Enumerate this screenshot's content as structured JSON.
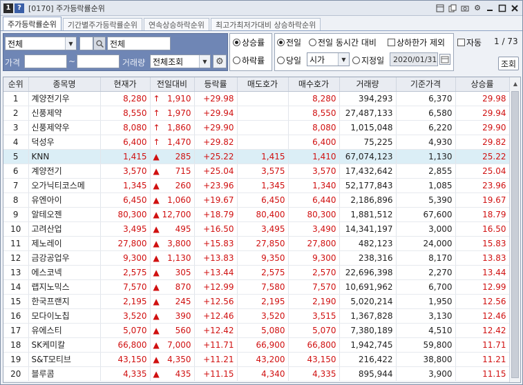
{
  "window": {
    "badge1": "1",
    "badge2": "?",
    "title": "[0170] 주가등락률순위",
    "icons": [
      "layout-icon",
      "copy-icon",
      "camera-icon",
      "gear-icon",
      "minimize-icon",
      "maximize-icon",
      "close-icon"
    ]
  },
  "tabs": [
    {
      "label": "주가등락률순위",
      "active": true
    },
    {
      "label": "기간별주가등락률순위",
      "active": false
    },
    {
      "label": "연속상승하락순위",
      "active": false
    },
    {
      "label": "최고가최저가대비 상승하락순위",
      "active": false
    }
  ],
  "filters": {
    "market_select": "전체",
    "code_input": "",
    "search_text": "전체",
    "price_label": "가격",
    "price_from": "",
    "tilde": "~",
    "price_to": "",
    "volume_label": "거래량",
    "volume_select": "전체조회"
  },
  "direction": {
    "rise": "상승률",
    "fall": "하락률",
    "selected": "rise"
  },
  "basis": {
    "prev_day": "전일",
    "prev_same_time": "전일 동시간 대비",
    "limit_exclude": "상하한가 제외",
    "today": "당일",
    "today_select": "시가",
    "set_day": "지정일",
    "date": "2020/01/31"
  },
  "auto_label": "자동",
  "pager": "1 / 73",
  "query_button": "조회",
  "columns": [
    "순위",
    "종목명",
    "현재가",
    "전일대비",
    "등락률",
    "매도호가",
    "매수호가",
    "거래량",
    "기준가격",
    "상승률"
  ],
  "rows": [
    {
      "rank": "1",
      "name": "계양전기우",
      "price": "8,280",
      "arrow": "↑",
      "chg": "1,910",
      "rate": "+29.98",
      "ask": "",
      "bid": "8,280",
      "volume": "394,293",
      "base": "6,370",
      "rise": "29.98"
    },
    {
      "rank": "2",
      "name": "신풍제약",
      "price": "8,550",
      "arrow": "↑",
      "chg": "1,970",
      "rate": "+29.94",
      "ask": "",
      "bid": "8,550",
      "volume": "27,487,133",
      "base": "6,580",
      "rise": "29.94"
    },
    {
      "rank": "3",
      "name": "신풍제약우",
      "price": "8,080",
      "arrow": "↑",
      "chg": "1,860",
      "rate": "+29.90",
      "ask": "",
      "bid": "8,080",
      "volume": "1,015,048",
      "base": "6,220",
      "rise": "29.90"
    },
    {
      "rank": "4",
      "name": "덕성우",
      "price": "6,400",
      "arrow": "↑",
      "chg": "1,470",
      "rate": "+29.82",
      "ask": "",
      "bid": "6,400",
      "volume": "75,225",
      "base": "4,930",
      "rise": "29.82"
    },
    {
      "rank": "5",
      "name": "KNN",
      "price": "1,415",
      "arrow": "▲",
      "chg": "285",
      "rate": "+25.22",
      "ask": "1,415",
      "bid": "1,410",
      "volume": "67,074,123",
      "base": "1,130",
      "rise": "25.22"
    },
    {
      "rank": "6",
      "name": "계양전기",
      "price": "3,570",
      "arrow": "▲",
      "chg": "715",
      "rate": "+25.04",
      "ask": "3,575",
      "bid": "3,570",
      "volume": "17,432,642",
      "base": "2,855",
      "rise": "25.04"
    },
    {
      "rank": "7",
      "name": "오가닉티코스메",
      "price": "1,345",
      "arrow": "▲",
      "chg": "260",
      "rate": "+23.96",
      "ask": "1,345",
      "bid": "1,340",
      "volume": "52,177,843",
      "base": "1,085",
      "rise": "23.96"
    },
    {
      "rank": "8",
      "name": "유엔아이",
      "price": "6,450",
      "arrow": "▲",
      "chg": "1,060",
      "rate": "+19.67",
      "ask": "6,450",
      "bid": "6,440",
      "volume": "2,186,896",
      "base": "5,390",
      "rise": "19.67"
    },
    {
      "rank": "9",
      "name": "알테오젠",
      "price": "80,300",
      "arrow": "▲",
      "chg": "12,700",
      "rate": "+18.79",
      "ask": "80,400",
      "bid": "80,300",
      "volume": "1,881,512",
      "base": "67,600",
      "rise": "18.79"
    },
    {
      "rank": "10",
      "name": "고려산업",
      "price": "3,495",
      "arrow": "▲",
      "chg": "495",
      "rate": "+16.50",
      "ask": "3,495",
      "bid": "3,490",
      "volume": "14,341,197",
      "base": "3,000",
      "rise": "16.50"
    },
    {
      "rank": "11",
      "name": "제노레이",
      "price": "27,800",
      "arrow": "▲",
      "chg": "3,800",
      "rate": "+15.83",
      "ask": "27,850",
      "bid": "27,800",
      "volume": "482,123",
      "base": "24,000",
      "rise": "15.83"
    },
    {
      "rank": "12",
      "name": "금강공업우",
      "price": "9,300",
      "arrow": "▲",
      "chg": "1,130",
      "rate": "+13.83",
      "ask": "9,350",
      "bid": "9,300",
      "volume": "238,316",
      "base": "8,170",
      "rise": "13.83"
    },
    {
      "rank": "13",
      "name": "에스코넥",
      "price": "2,575",
      "arrow": "▲",
      "chg": "305",
      "rate": "+13.44",
      "ask": "2,575",
      "bid": "2,570",
      "volume": "22,696,398",
      "base": "2,270",
      "rise": "13.44"
    },
    {
      "rank": "14",
      "name": "랩지노믹스",
      "price": "7,570",
      "arrow": "▲",
      "chg": "870",
      "rate": "+12.99",
      "ask": "7,580",
      "bid": "7,570",
      "volume": "10,691,962",
      "base": "6,700",
      "rise": "12.99"
    },
    {
      "rank": "15",
      "name": "한국프랜지",
      "price": "2,195",
      "arrow": "▲",
      "chg": "245",
      "rate": "+12.56",
      "ask": "2,195",
      "bid": "2,190",
      "volume": "5,020,214",
      "base": "1,950",
      "rise": "12.56"
    },
    {
      "rank": "16",
      "name": "모다이노칩",
      "price": "3,520",
      "arrow": "▲",
      "chg": "390",
      "rate": "+12.46",
      "ask": "3,520",
      "bid": "3,515",
      "volume": "1,367,828",
      "base": "3,130",
      "rise": "12.46"
    },
    {
      "rank": "17",
      "name": "유에스티",
      "price": "5,070",
      "arrow": "▲",
      "chg": "560",
      "rate": "+12.42",
      "ask": "5,080",
      "bid": "5,070",
      "volume": "7,380,189",
      "base": "4,510",
      "rise": "12.42"
    },
    {
      "rank": "18",
      "name": "SK케미칼",
      "price": "66,800",
      "arrow": "▲",
      "chg": "7,000",
      "rate": "+11.71",
      "ask": "66,900",
      "bid": "66,800",
      "volume": "1,942,745",
      "base": "59,800",
      "rise": "11.71"
    },
    {
      "rank": "19",
      "name": "S&T모티브",
      "price": "43,150",
      "arrow": "▲",
      "chg": "4,350",
      "rate": "+11.21",
      "ask": "43,200",
      "bid": "43,150",
      "volume": "216,422",
      "base": "38,800",
      "rise": "11.21"
    },
    {
      "rank": "20",
      "name": "블루콤",
      "price": "4,335",
      "arrow": "▲",
      "chg": "435",
      "rate": "+11.15",
      "ask": "4,340",
      "bid": "4,335",
      "volume": "895,944",
      "base": "3,900",
      "rise": "11.15"
    }
  ],
  "highlight_rank": "5",
  "colors": {
    "up": "#d01010",
    "highlight": "#dbeef6",
    "panel": "#6f86b5"
  }
}
